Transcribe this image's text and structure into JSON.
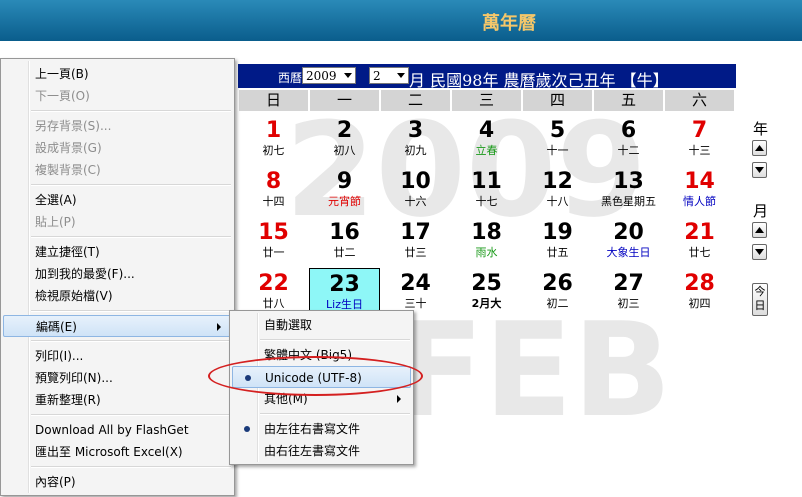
{
  "window": {
    "title": "萬年曆"
  },
  "calendar": {
    "watermark_year": "2009",
    "watermark_month": "FEB",
    "header": {
      "era_label": "西曆",
      "year_value": "2009",
      "month_value": "2",
      "text": "月 民國98年  農曆歲次己丑年  【牛】"
    },
    "weekdays": [
      "日",
      "一",
      "二",
      "三",
      "四",
      "五",
      "六"
    ],
    "days": [
      {
        "d": "1",
        "l": "初七",
        "dc": "#e00000",
        "lc": "#000"
      },
      {
        "d": "2",
        "l": "初八",
        "dc": "#000",
        "lc": "#000"
      },
      {
        "d": "3",
        "l": "初九",
        "dc": "#000",
        "lc": "#000"
      },
      {
        "d": "4",
        "l": "立春",
        "dc": "#000",
        "lc": "#1a9a1a"
      },
      {
        "d": "5",
        "l": "十一",
        "dc": "#000",
        "lc": "#000"
      },
      {
        "d": "6",
        "l": "十二",
        "dc": "#000",
        "lc": "#000"
      },
      {
        "d": "7",
        "l": "十三",
        "dc": "#e00000",
        "lc": "#000"
      },
      {
        "d": "8",
        "l": "十四",
        "dc": "#e00000",
        "lc": "#000"
      },
      {
        "d": "9",
        "l": "元宵節",
        "dc": "#000",
        "lc": "#e00000"
      },
      {
        "d": "10",
        "l": "十六",
        "dc": "#000",
        "lc": "#000"
      },
      {
        "d": "11",
        "l": "十七",
        "dc": "#000",
        "lc": "#000"
      },
      {
        "d": "12",
        "l": "十八",
        "dc": "#000",
        "lc": "#000"
      },
      {
        "d": "13",
        "l": "黑色星期五",
        "dc": "#000",
        "lc": "#000"
      },
      {
        "d": "14",
        "l": "情人節",
        "dc": "#e00000",
        "lc": "#0000c0"
      },
      {
        "d": "15",
        "l": "廿一",
        "dc": "#e00000",
        "lc": "#000"
      },
      {
        "d": "16",
        "l": "廿二",
        "dc": "#000",
        "lc": "#000"
      },
      {
        "d": "17",
        "l": "廿三",
        "dc": "#000",
        "lc": "#000"
      },
      {
        "d": "18",
        "l": "雨水",
        "dc": "#000",
        "lc": "#1a9a1a"
      },
      {
        "d": "19",
        "l": "廿五",
        "dc": "#000",
        "lc": "#000"
      },
      {
        "d": "20",
        "l": "大象生日",
        "dc": "#000",
        "lc": "#0000c0"
      },
      {
        "d": "21",
        "l": "廿七",
        "dc": "#e00000",
        "lc": "#000"
      },
      {
        "d": "22",
        "l": "廿八",
        "dc": "#e00000",
        "lc": "#000"
      },
      {
        "d": "23",
        "l": "Liz生日",
        "dc": "#000",
        "lc": "#0000c0",
        "today": true
      },
      {
        "d": "24",
        "l": "三十",
        "dc": "#000",
        "lc": "#000"
      },
      {
        "d": "25",
        "l": "2月大",
        "dc": "#000",
        "lc": "#000",
        "lb": true
      },
      {
        "d": "26",
        "l": "初二",
        "dc": "#000",
        "lc": "#000"
      },
      {
        "d": "27",
        "l": "初三",
        "dc": "#000",
        "lc": "#000"
      },
      {
        "d": "28",
        "l": "初四",
        "dc": "#e00000",
        "lc": "#000"
      }
    ],
    "side": {
      "year_label": "年",
      "month_label": "月",
      "today_label_1": "今",
      "today_label_2": "日"
    }
  },
  "context_menu": {
    "back": "上一頁(B)",
    "forward": "下一頁(O)",
    "save_bg": "另存背景(S)...",
    "set_bg": "設成背景(G)",
    "copy_bg": "複製背景(C)",
    "select_all": "全選(A)",
    "paste": "貼上(P)",
    "create_shortcut": "建立捷徑(T)",
    "add_favorites": "加到我的最愛(F)...",
    "view_source": "檢視原始檔(V)",
    "encoding": "編碼(E)",
    "print": "列印(I)...",
    "print_preview": "預覽列印(N)...",
    "refresh": "重新整理(R)",
    "flashget": "Download All by FlashGet",
    "excel": "匯出至 Microsoft Excel(X)",
    "properties": "內容(P)"
  },
  "encoding_menu": {
    "auto_select": "自動選取",
    "big5": "繁體中文 (Big5)",
    "utf8": "Unicode (UTF-8)",
    "more": "其他(M)",
    "ltr": "由左往右書寫文件",
    "rtl": "由右往左書寫文件"
  },
  "colors": {
    "header_bg": "#001a87",
    "titlebar": "#0a5d8c",
    "today_bg": "#8ef7f7",
    "annotation": "#d42020"
  }
}
